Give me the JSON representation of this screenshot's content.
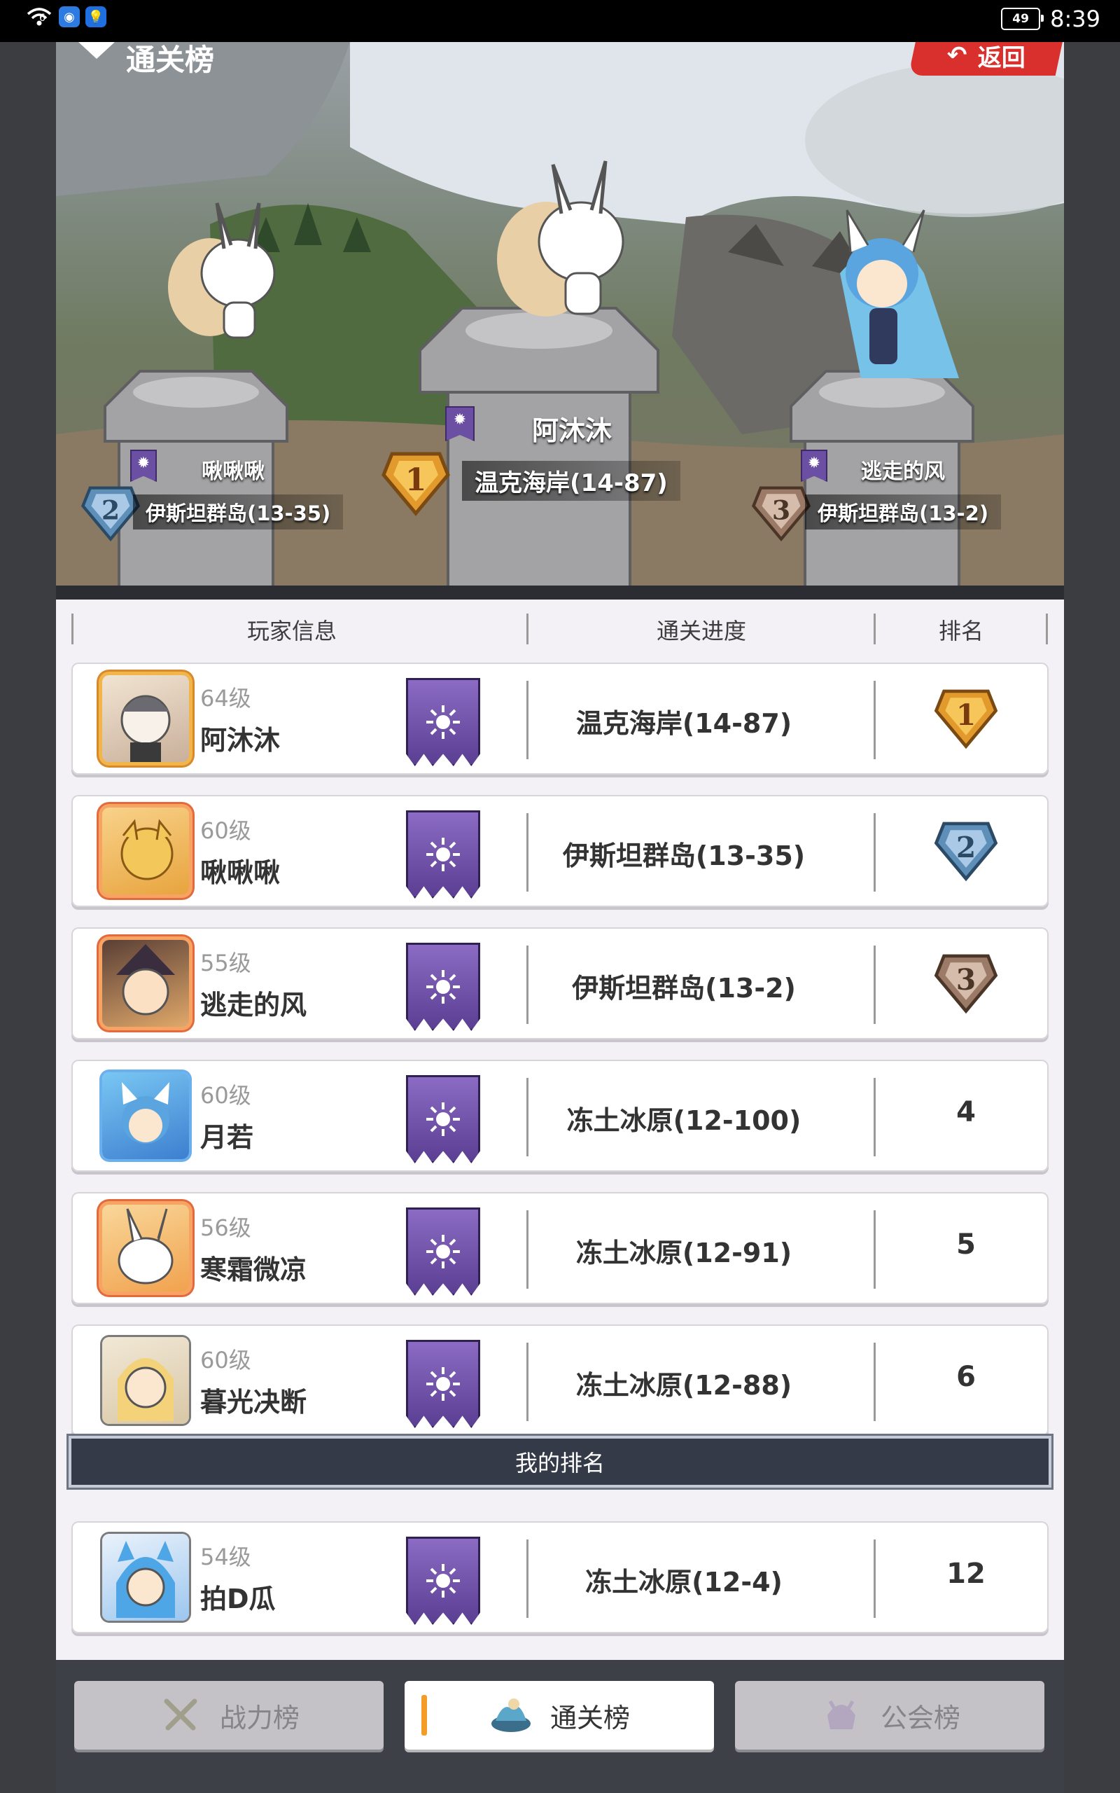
{
  "status_bar": {
    "signal": "6",
    "battery": "49",
    "time": "8:39"
  },
  "hero": {
    "title": "通关榜",
    "back_label": "返回",
    "podium": [
      {
        "rank": "1",
        "name": "阿沐沐",
        "progress": "温克海岸(14-87)"
      },
      {
        "rank": "2",
        "name": "啾啾啾",
        "progress": "伊斯坦群岛(13-35)"
      },
      {
        "rank": "3",
        "name": "逃走的风",
        "progress": "伊斯坦群岛(13-2)"
      }
    ]
  },
  "table": {
    "headers": {
      "player": "玩家信息",
      "progress": "通关进度",
      "rank": "排名"
    },
    "rows": [
      {
        "level": "64级",
        "name": "阿沐沐",
        "progress": "温克海岸(14-87)",
        "rank": "1"
      },
      {
        "level": "60级",
        "name": "啾啾啾",
        "progress": "伊斯坦群岛(13-35)",
        "rank": "2"
      },
      {
        "level": "55级",
        "name": "逃走的风",
        "progress": "伊斯坦群岛(13-2)",
        "rank": "3"
      },
      {
        "level": "60级",
        "name": "月若",
        "progress": "冻土冰原(12-100)",
        "rank": "4"
      },
      {
        "level": "56级",
        "name": "寒霜微凉",
        "progress": "冻土冰原(12-91)",
        "rank": "5"
      },
      {
        "level": "60级",
        "name": "暮光决断",
        "progress": "冻土冰原(12-88)",
        "rank": "6"
      }
    ]
  },
  "my_rank": {
    "label": "我的排名",
    "row": {
      "level": "54级",
      "name": "拍D瓜",
      "progress": "冻土冰原(12-4)",
      "rank": "12"
    }
  },
  "tabs": [
    {
      "label": "战力榜",
      "icon": "swords-icon",
      "active": false
    },
    {
      "label": "通关榜",
      "icon": "map-island-icon",
      "active": true
    },
    {
      "label": "公会榜",
      "icon": "guild-helmet-icon",
      "active": false
    }
  ],
  "colors": {
    "accent": "#f39c27",
    "guild_banner": "#6b4fa2",
    "gold": "#e39a2c",
    "silver": "#5e8fb8",
    "bronze": "#9c7a68"
  }
}
